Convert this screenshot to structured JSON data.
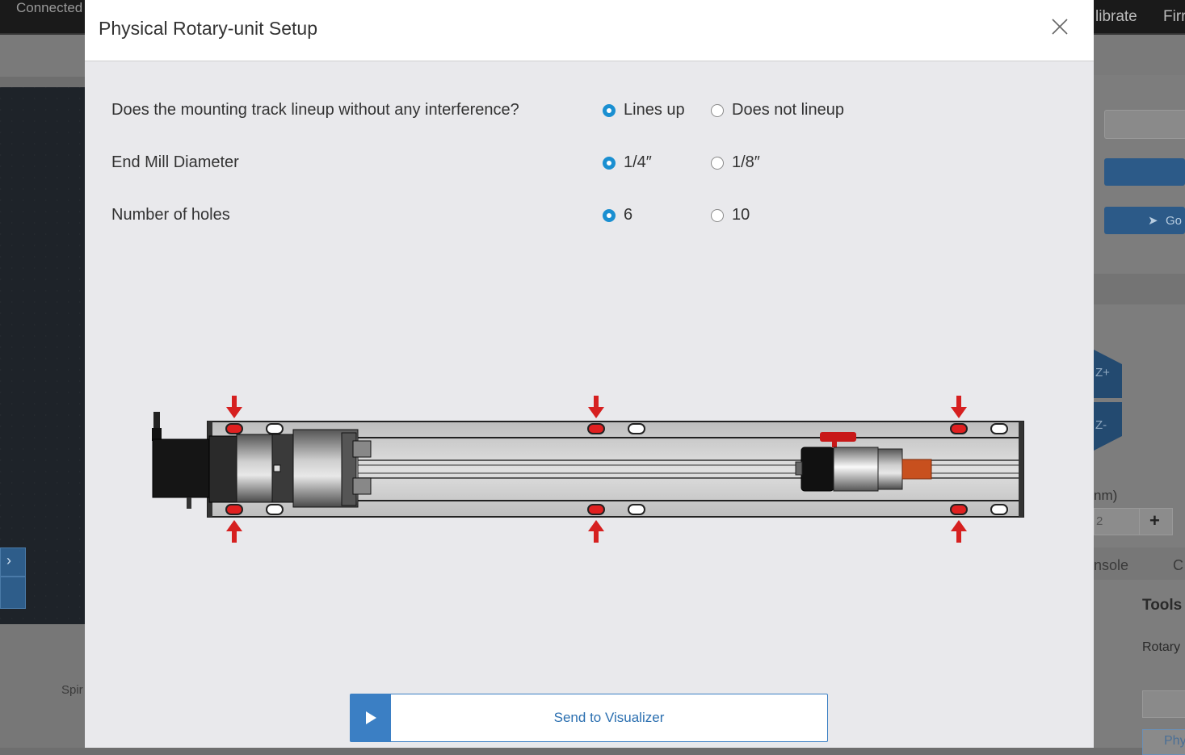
{
  "background": {
    "status_text": "Connected",
    "menu_calibrate": "librate",
    "menu_firmware": "Firr",
    "go_label": "Go",
    "jog_z_plus": "Z+",
    "jog_z_minus": "Z-",
    "step_unit": "nm)",
    "step_value": "2",
    "plus_label": "+",
    "tab_console": "nsole",
    "tab_c": "C",
    "tools_heading": "Tools",
    "tools_item": "Rotary",
    "tools_button": "Phy",
    "spindle_label": "Spir"
  },
  "modal": {
    "title": "Physical Rotary-unit Setup",
    "rows": [
      {
        "label": "Does the mounting track lineup without any interference?",
        "options": [
          "Lines up",
          "Does not lineup"
        ],
        "selected": 0
      },
      {
        "label": "End Mill Diameter",
        "options": [
          "1/4″",
          "1/8″"
        ],
        "selected": 0
      },
      {
        "label": "Number of holes",
        "options": [
          "6",
          "10"
        ],
        "selected": 0
      }
    ],
    "send_button": "Send to Visualizer"
  },
  "colors": {
    "accent": "#1a8fd1",
    "button_blue": "#3b7fc4",
    "arrow_red": "#d62020"
  }
}
